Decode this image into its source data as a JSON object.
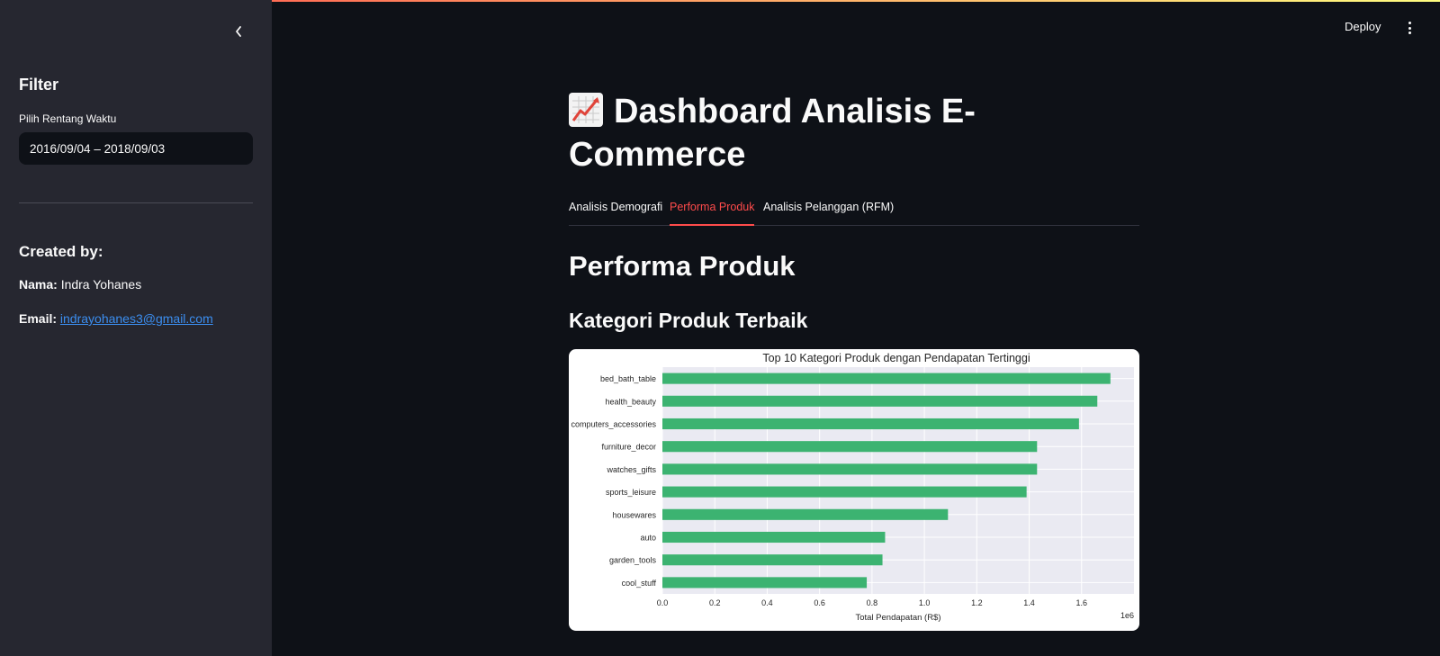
{
  "sidebar": {
    "heading": "Filter",
    "date_label": "Pilih Rentang Waktu",
    "date_value": "2016/09/04 – 2018/09/03",
    "created_heading": "Created by:",
    "name_label": "Nama:",
    "name_value": "Indra Yohanes",
    "email_label": "Email:",
    "email_value": "indrayohanes3@gmail.com"
  },
  "header": {
    "deploy_label": "Deploy"
  },
  "main": {
    "title": "Dashboard Analisis E-Commerce",
    "title_icon": "chart-increasing-icon",
    "tabs": [
      {
        "label": "Analisis Demografi",
        "active": false
      },
      {
        "label": "Performa Produk",
        "active": true
      },
      {
        "label": "Analisis Pelanggan (RFM)",
        "active": false
      }
    ],
    "section_title": "Performa Produk",
    "subsection_title": "Kategori Produk Terbaik"
  },
  "colors": {
    "accent": "#ff4b4b",
    "bar": "#3cb371",
    "link": "#3b8ef0"
  },
  "chart_data": {
    "type": "bar",
    "orientation": "horizontal",
    "title": "Top 10 Kategori Produk dengan Pendapatan Tertinggi",
    "xlabel": "Total Pendapatan (R$)",
    "ylabel": "",
    "x_scale_label": "1e6",
    "xlim": [
      0,
      1.8
    ],
    "xticks": [
      "0.0",
      "0.2",
      "0.4",
      "0.6",
      "0.8",
      "1.0",
      "1.2",
      "1.4",
      "1.6"
    ],
    "grid": true,
    "categories": [
      "bed_bath_table",
      "health_beauty",
      "computers_accessories",
      "furniture_decor",
      "watches_gifts",
      "sports_leisure",
      "housewares",
      "auto",
      "garden_tools",
      "cool_stuff"
    ],
    "values": [
      1.71,
      1.66,
      1.59,
      1.43,
      1.43,
      1.39,
      1.09,
      0.85,
      0.84,
      0.78
    ]
  }
}
